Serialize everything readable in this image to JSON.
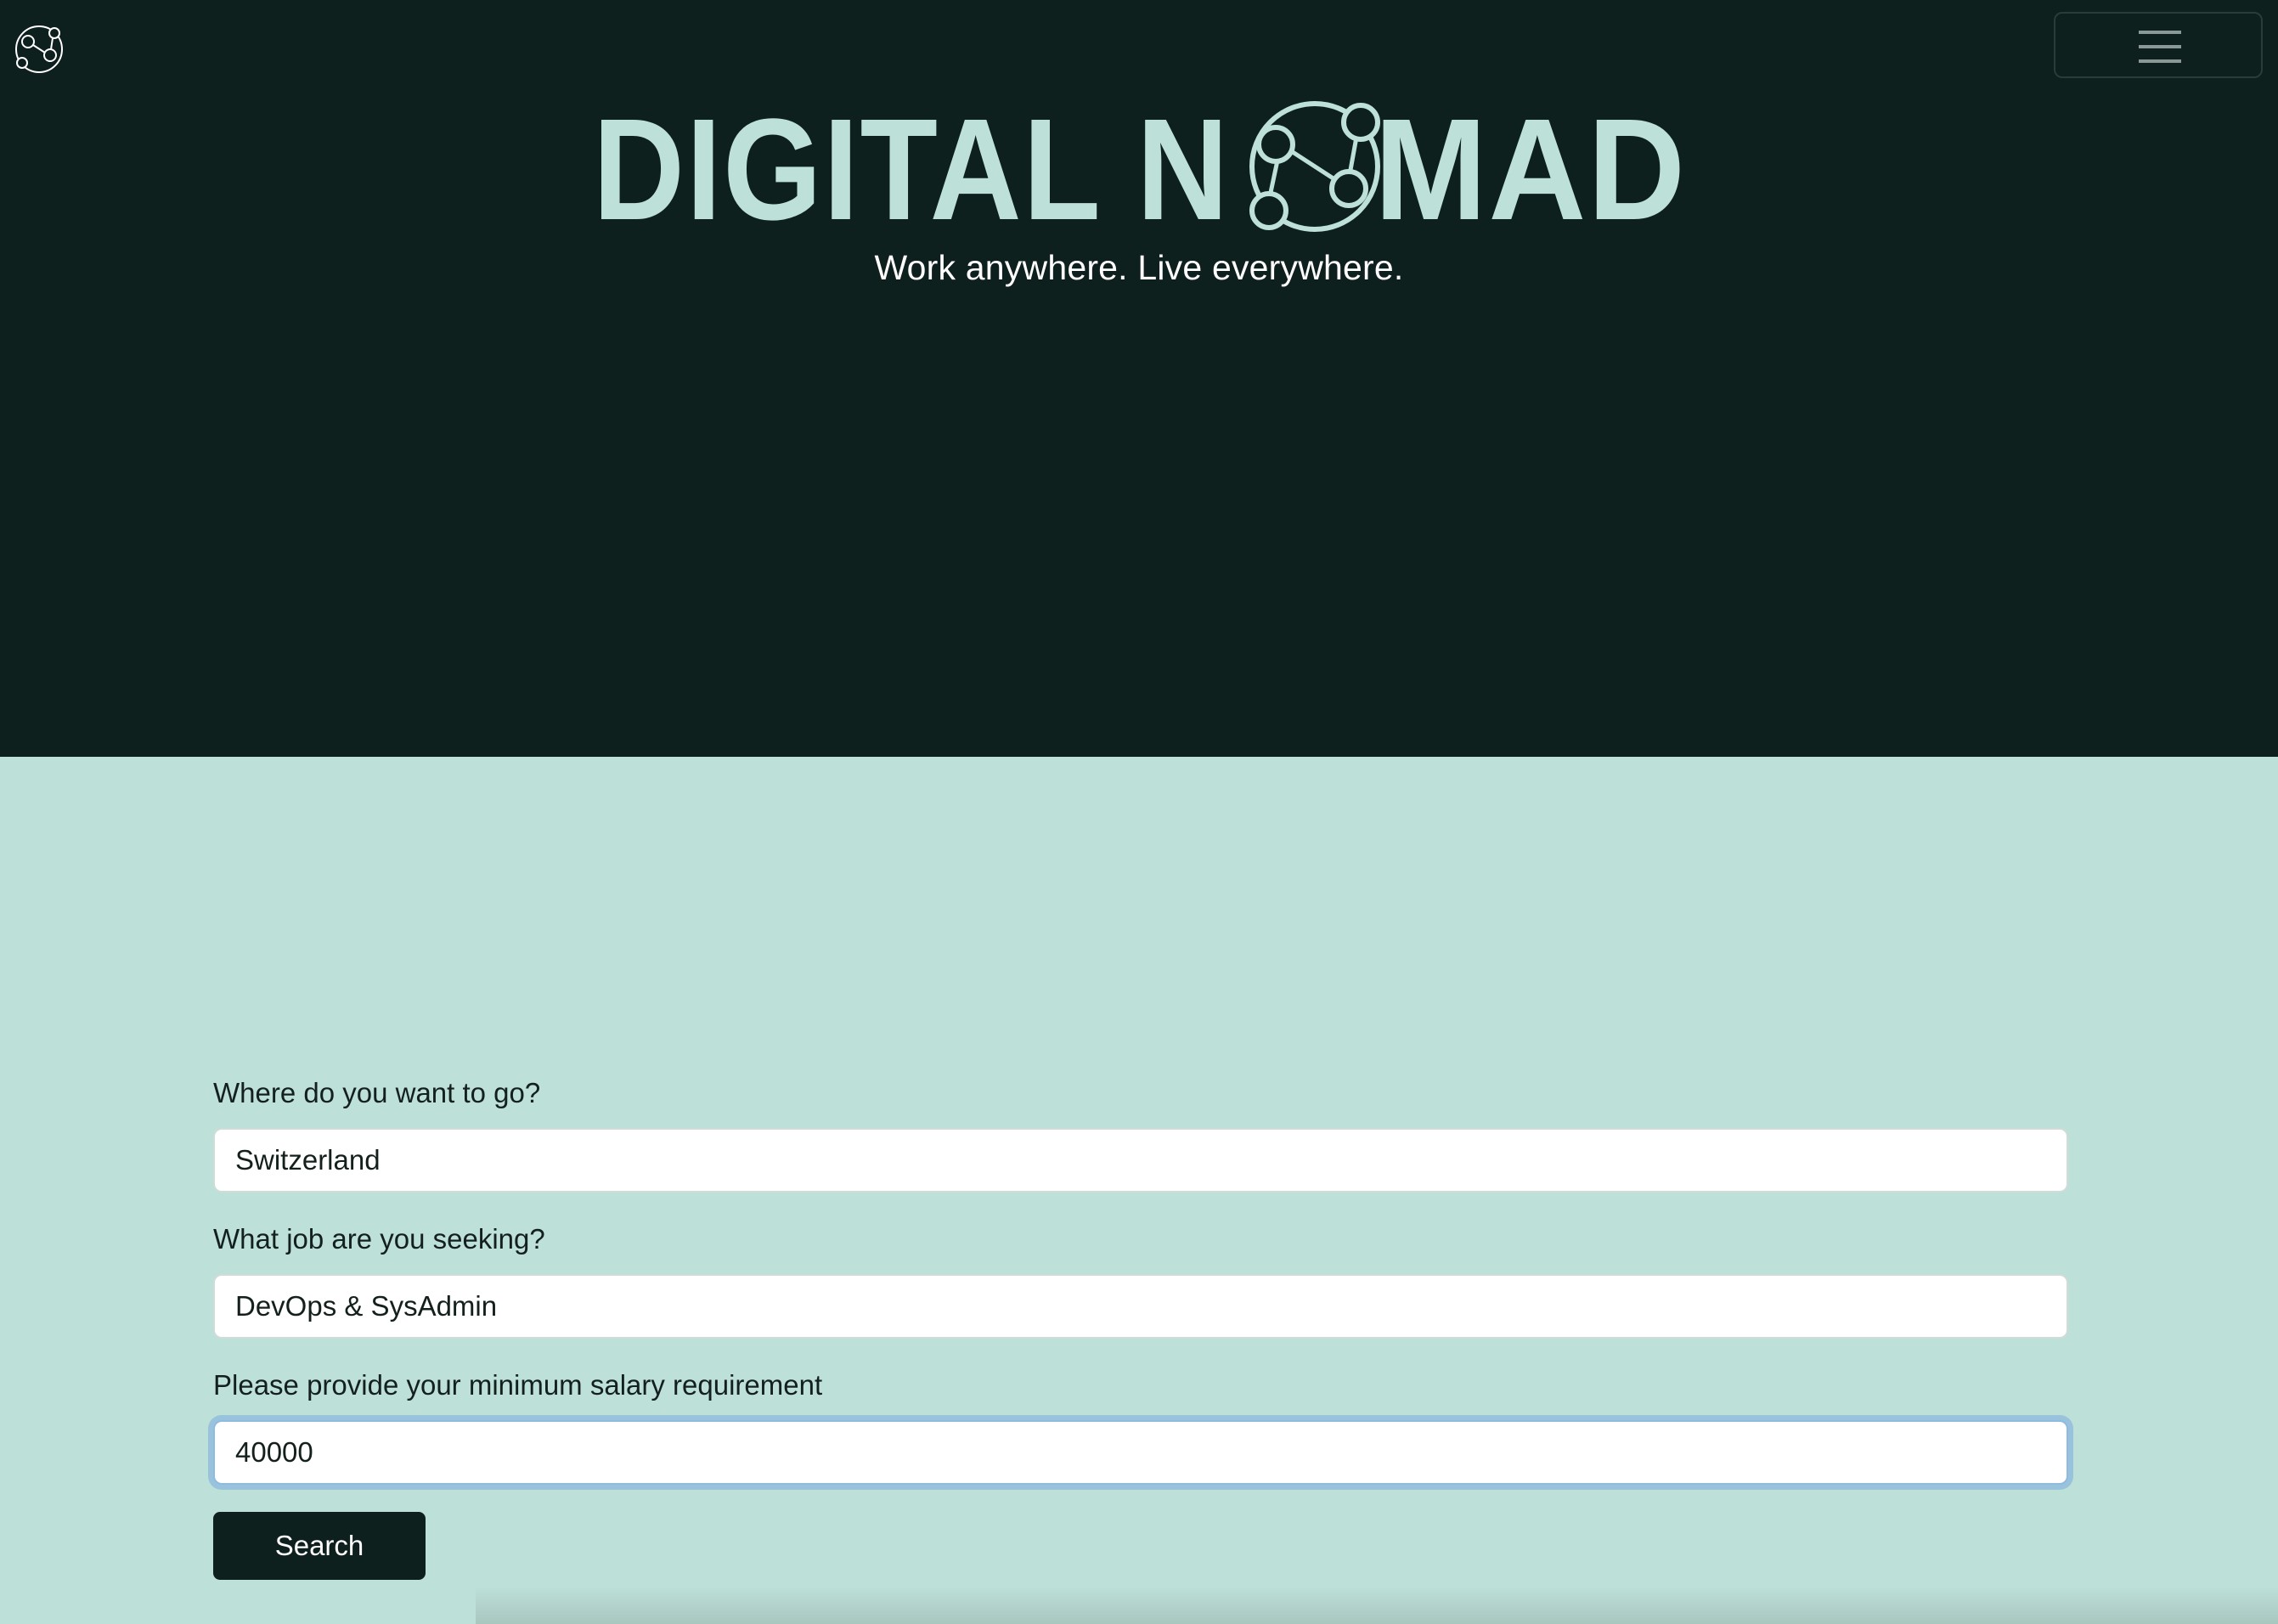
{
  "colors": {
    "hero_background": "#0e201e",
    "page_background": "#bde0d8",
    "brand_mint": "#bde0d8",
    "button_background": "#0e201e",
    "focus_ring": "#7caae2"
  },
  "header": {
    "logo_icon": "network-globe-icon",
    "menu_icon": "hamburger-icon"
  },
  "hero": {
    "brand_left": "DIGITAL N",
    "brand_right": "MAD",
    "brand_o_icon": "network-globe-icon",
    "tagline": "Work anywhere. Live everywhere."
  },
  "form": {
    "destination": {
      "label": "Where do you want to go?",
      "value": "Switzerland"
    },
    "job": {
      "label": "What job are you seeking?",
      "value": "DevOps & SysAdmin"
    },
    "salary": {
      "label": "Please provide your minimum salary requirement",
      "value": "40000"
    },
    "submit_label": "Search"
  }
}
